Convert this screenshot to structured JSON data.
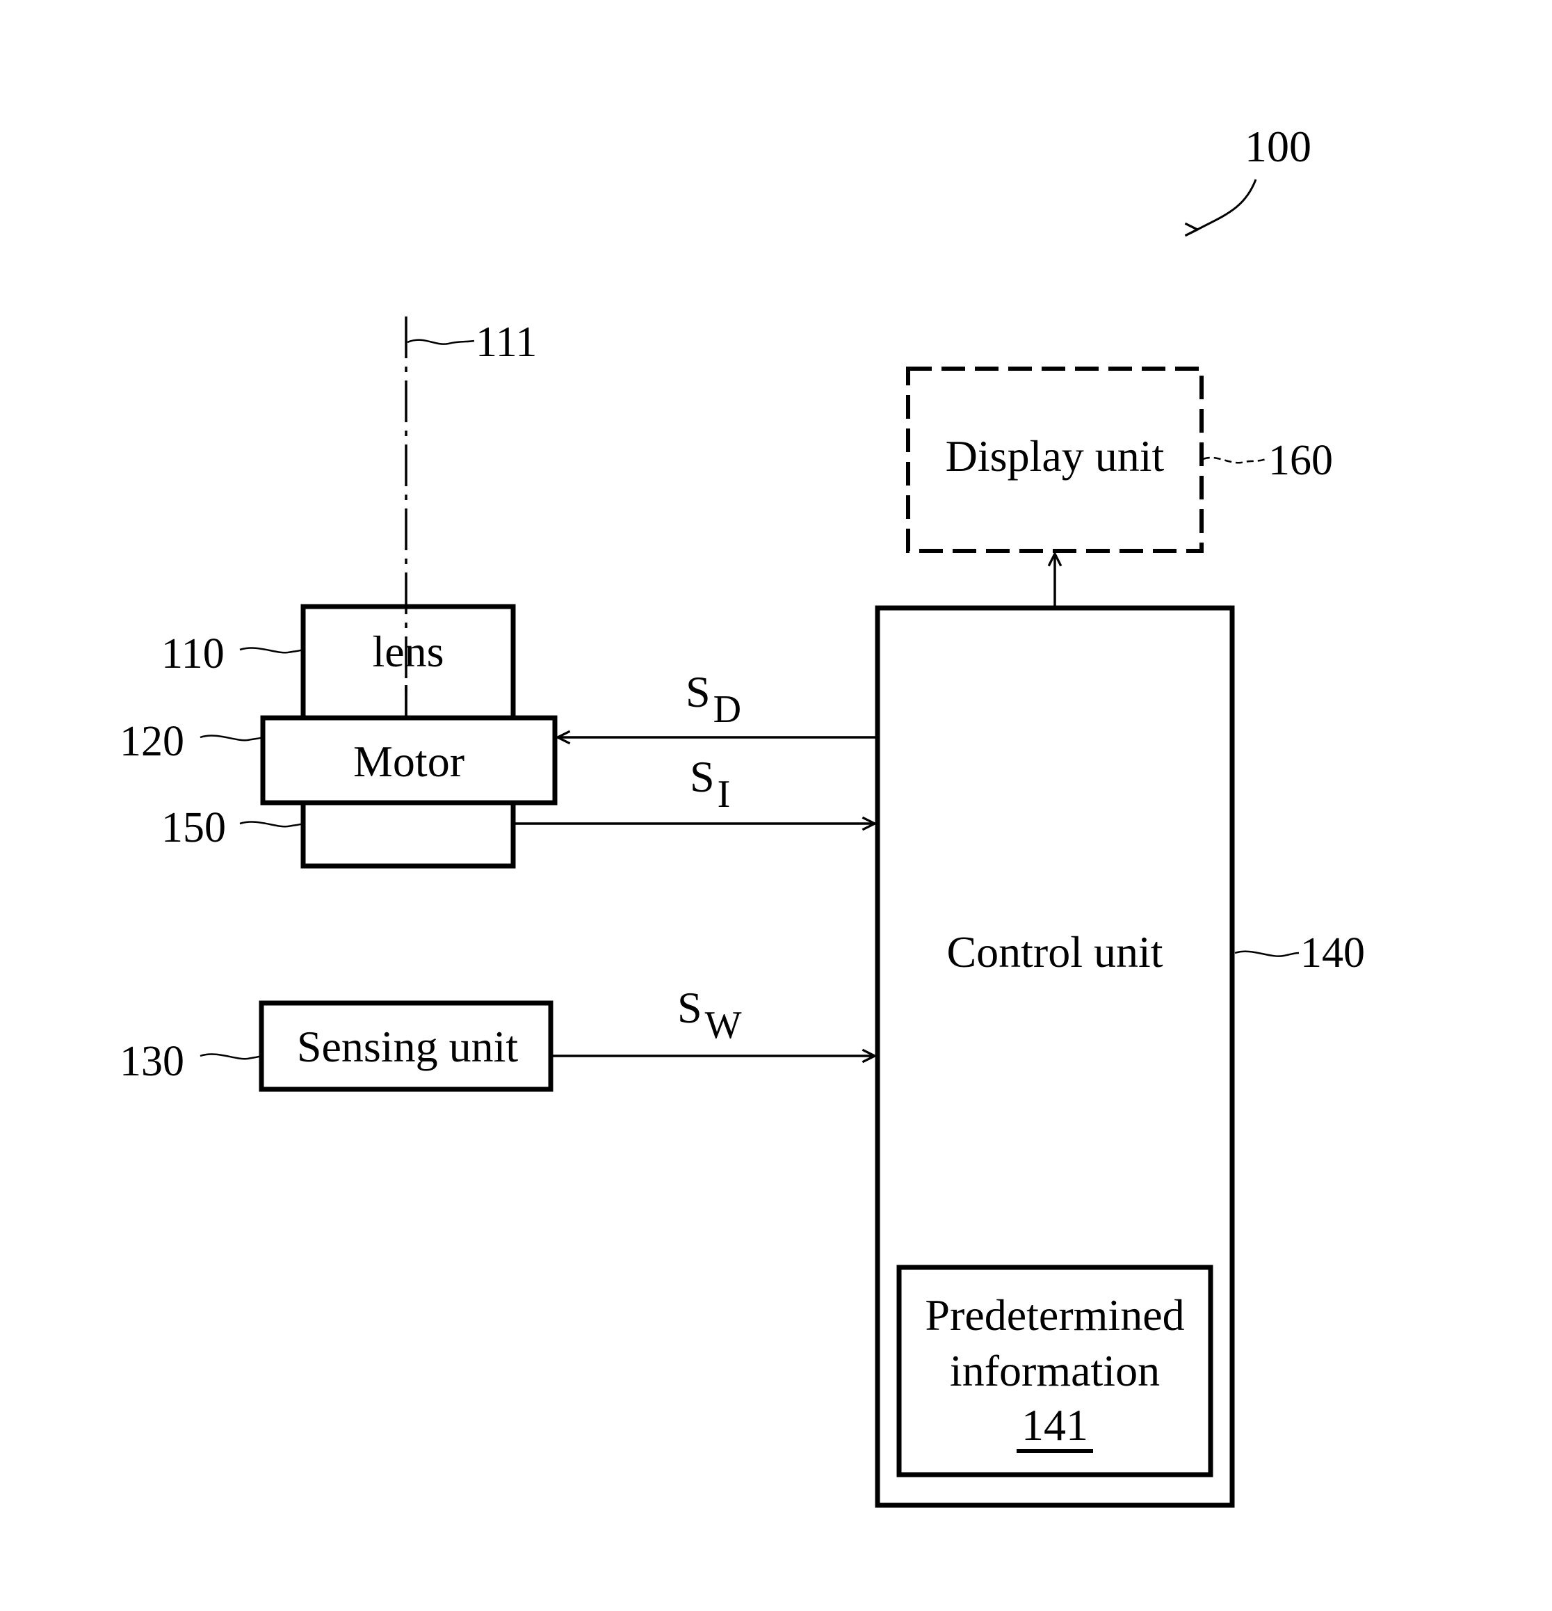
{
  "figure": {
    "system_ref": "100",
    "optical_axis_ref": "111"
  },
  "blocks": {
    "lens": {
      "label": "lens",
      "ref": "110"
    },
    "motor": {
      "label": "Motor",
      "ref": "120"
    },
    "position_sensor": {
      "label": "",
      "ref": "150"
    },
    "sensing_unit": {
      "label": "Sensing unit",
      "ref": "130"
    },
    "control_unit": {
      "label": "Control unit",
      "ref": "140"
    },
    "display_unit": {
      "label": "Display unit",
      "ref": "160",
      "style": "dashed"
    },
    "predetermined_info": {
      "line1": "Predetermined",
      "line2": "information",
      "ref": "141"
    }
  },
  "signals": {
    "sd": {
      "main": "S",
      "sub": "D",
      "direction": "control-to-motor"
    },
    "si": {
      "main": "S",
      "sub": "I",
      "direction": "150-to-control"
    },
    "sw": {
      "main": "S",
      "sub": "W",
      "direction": "sensing-to-control"
    }
  }
}
